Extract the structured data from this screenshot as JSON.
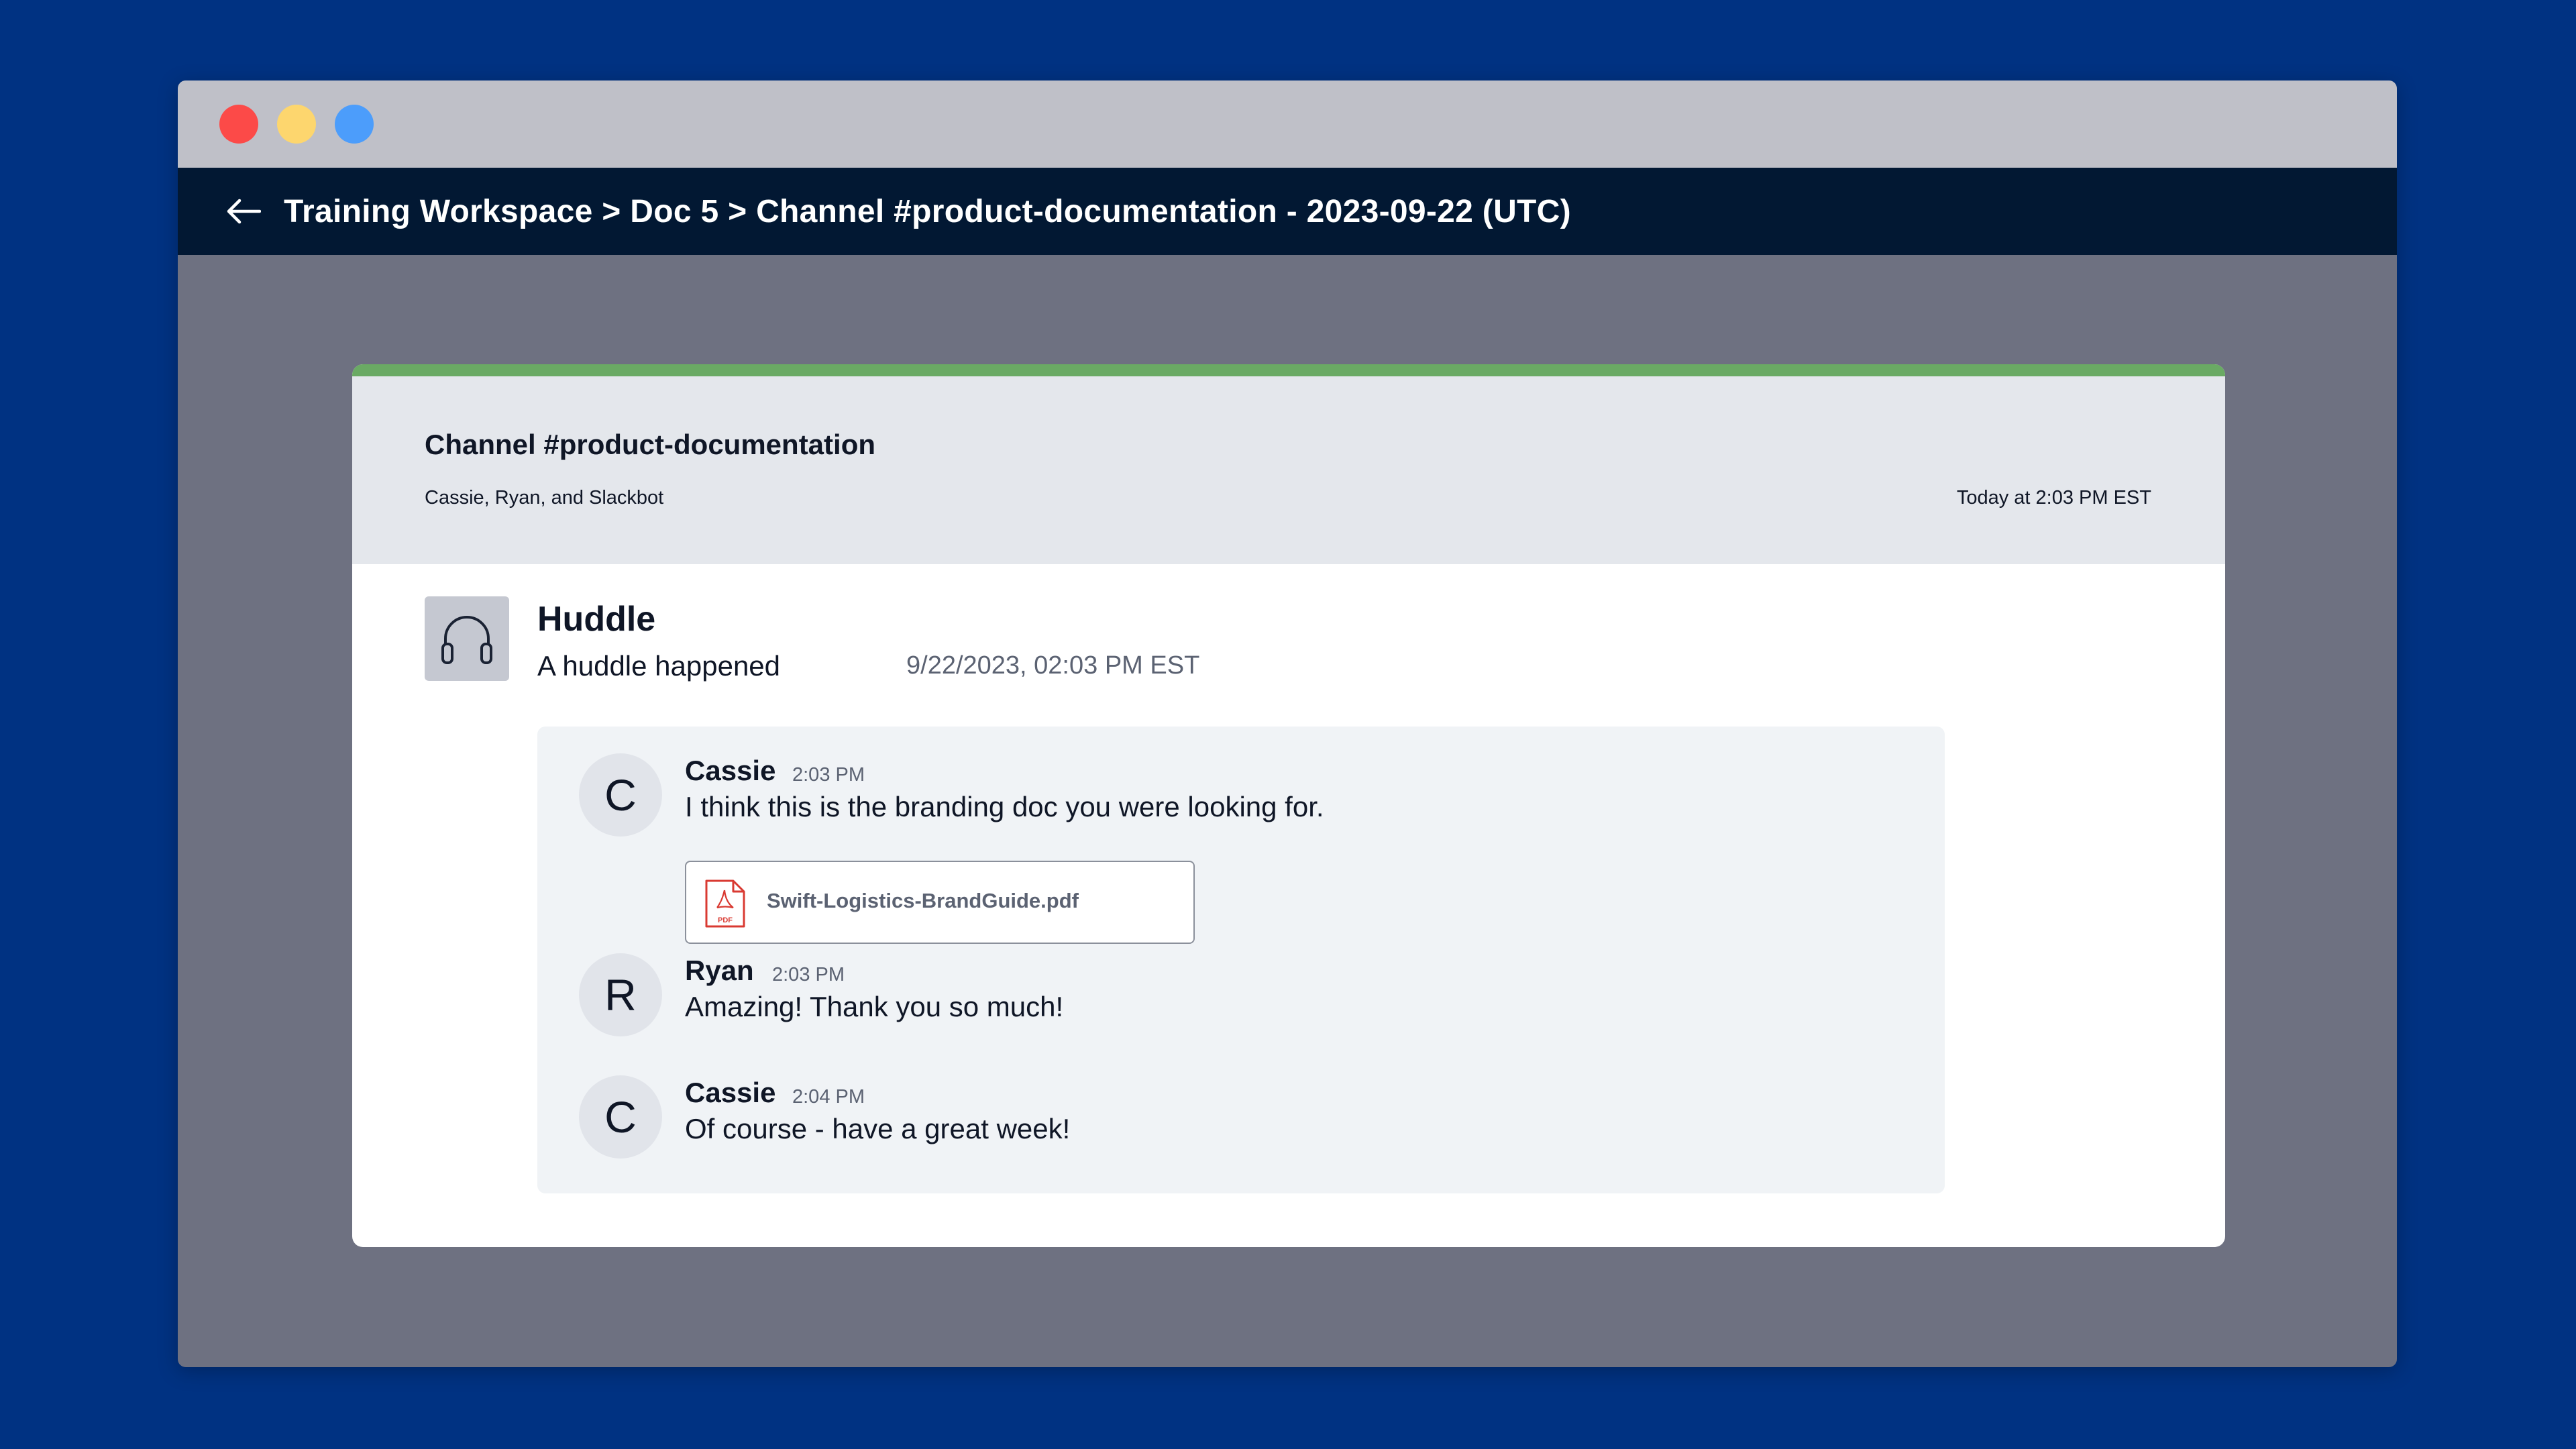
{
  "window": {
    "controls": [
      "close",
      "minimize",
      "maximize"
    ]
  },
  "nav": {
    "back_icon": "arrow-left-icon",
    "breadcrumb": "Training Workspace > Doc 5 > Channel #product-documentation - 2023-09-22 (UTC)"
  },
  "card": {
    "accent_color": "#6aaa64",
    "title": "Channel #product-documentation",
    "participants": "Cassie, Ryan, and Slackbot",
    "time": "Today at 2:03 PM EST"
  },
  "huddle": {
    "icon": "headphones-icon",
    "title": "Huddle",
    "subtitle": "A huddle happened",
    "datetime": "9/22/2023, 02:03 PM EST"
  },
  "messages": [
    {
      "initial": "C",
      "name": "Cassie",
      "time": "2:03 PM",
      "text": "I think this is the branding doc you were looking for.",
      "attachment": {
        "icon": "pdf-file-icon",
        "icon_label": "PDF",
        "filename": "Swift-Logistics-BrandGuide.pdf"
      }
    },
    {
      "initial": "R",
      "name": "Ryan",
      "time": "2:03 PM",
      "text": "Amazing! Thank you so much!"
    },
    {
      "initial": "C",
      "name": "Cassie",
      "time": "2:04 PM",
      "text": "Of course - have a great week!"
    }
  ]
}
